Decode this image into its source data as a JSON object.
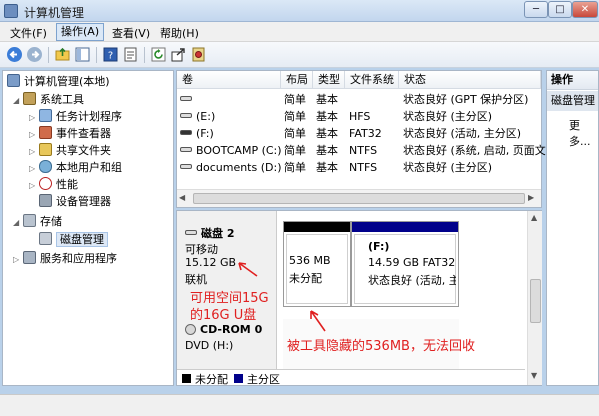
{
  "window": {
    "title": "计算机管理",
    "minimize": "─",
    "maximize": "□",
    "close": "✕"
  },
  "menu": [
    "文件(F)",
    "操作(A)",
    "查看(V)",
    "帮助(H)"
  ],
  "toolbar": [
    "back-arrow-icon",
    "forward-arrow-icon",
    "up-folder-icon",
    "show-tree-icon",
    "help-icon",
    "properties-icon",
    "refresh-icon",
    "export-icon",
    "settings-icon"
  ],
  "tree": {
    "root": "计算机管理(本地)",
    "system_tools": "系统工具",
    "task_scheduler": "任务计划程序",
    "event_viewer": "事件查看器",
    "shared_folders": "共享文件夹",
    "local_users": "本地用户和组",
    "performance": "性能",
    "device_manager": "设备管理器",
    "storage": "存储",
    "disk_management": "磁盘管理",
    "services_apps": "服务和应用程序"
  },
  "volumes": {
    "headers": [
      "卷",
      "布局",
      "类型",
      "文件系统",
      "状态"
    ],
    "rows": [
      {
        "vol": "",
        "layout": "简单",
        "type": "基本",
        "fs": "",
        "status": "状态良好 (GPT 保护分区)"
      },
      {
        "vol": "(E:)",
        "layout": "简单",
        "type": "基本",
        "fs": "HFS",
        "status": "状态良好 (主分区)"
      },
      {
        "vol": "(F:)",
        "layout": "简单",
        "type": "基本",
        "fs": "FAT32",
        "status": "状态良好 (活动, 主分区)"
      },
      {
        "vol": "BOOTCAMP (C:)",
        "layout": "简单",
        "type": "基本",
        "fs": "NTFS",
        "status": "状态良好 (系统, 启动, 页面文"
      },
      {
        "vol": "documents (D:)",
        "layout": "简单",
        "type": "基本",
        "fs": "NTFS",
        "status": "状态良好 (主分区)"
      }
    ]
  },
  "disk2": {
    "name": "磁盘 2",
    "kind": "可移动",
    "size": "15.12 GB",
    "state": "联机",
    "unalloc_size": "536 MB",
    "unalloc_label": "未分配",
    "part_name": "(F:)",
    "part_size": "14.59 GB FAT32",
    "part_status": "状态良好 (活动, 主分区"
  },
  "cdrom": {
    "name": "CD-ROM 0",
    "drive": "DVD (H:)"
  },
  "annotations": {
    "line1": "可用空间15G",
    "line2": "的16G U盘",
    "hidden_note": "被工具隐藏的536MB，无法回收"
  },
  "actions": {
    "title": "操作",
    "disk_mgmt": "磁盘管理",
    "more": "更多..."
  },
  "legend": {
    "unallocated": "未分配",
    "primary": "主分区"
  },
  "colors": {
    "unallocated": "#000000",
    "primary": "#00008a",
    "annotation": "#e02020"
  }
}
